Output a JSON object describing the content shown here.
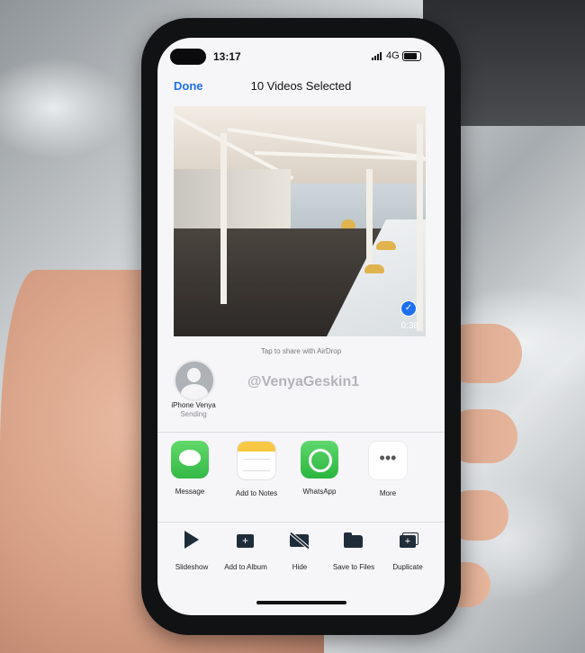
{
  "status": {
    "time": "13:17",
    "network": "4G"
  },
  "nav": {
    "done_label": "Done",
    "title": "10 Videos Selected"
  },
  "photo": {
    "duration": "0:38",
    "selected": true
  },
  "airdrop": {
    "hint": "Tap to share with AirDrop",
    "device_name": "iPhone Venya",
    "device_status": "Sending"
  },
  "watermark": "@VenyaGeskin1",
  "apps": [
    {
      "label": "Message",
      "icon": "messages-icon"
    },
    {
      "label": "Add to Notes",
      "icon": "notes-icon"
    },
    {
      "label": "WhatsApp",
      "icon": "whatsapp-icon"
    },
    {
      "label": "More",
      "icon": "more-icon"
    }
  ],
  "actions": [
    {
      "label": "Slideshow",
      "icon": "play-icon"
    },
    {
      "label": "Add to Album",
      "icon": "add-to-album-icon"
    },
    {
      "label": "Hide",
      "icon": "hide-icon"
    },
    {
      "label": "Save to Files",
      "icon": "folder-icon"
    },
    {
      "label": "Duplicate",
      "icon": "duplicate-icon"
    }
  ],
  "colors": {
    "accent": "#1e6ff2",
    "action_icon": "#1f2d3a"
  }
}
